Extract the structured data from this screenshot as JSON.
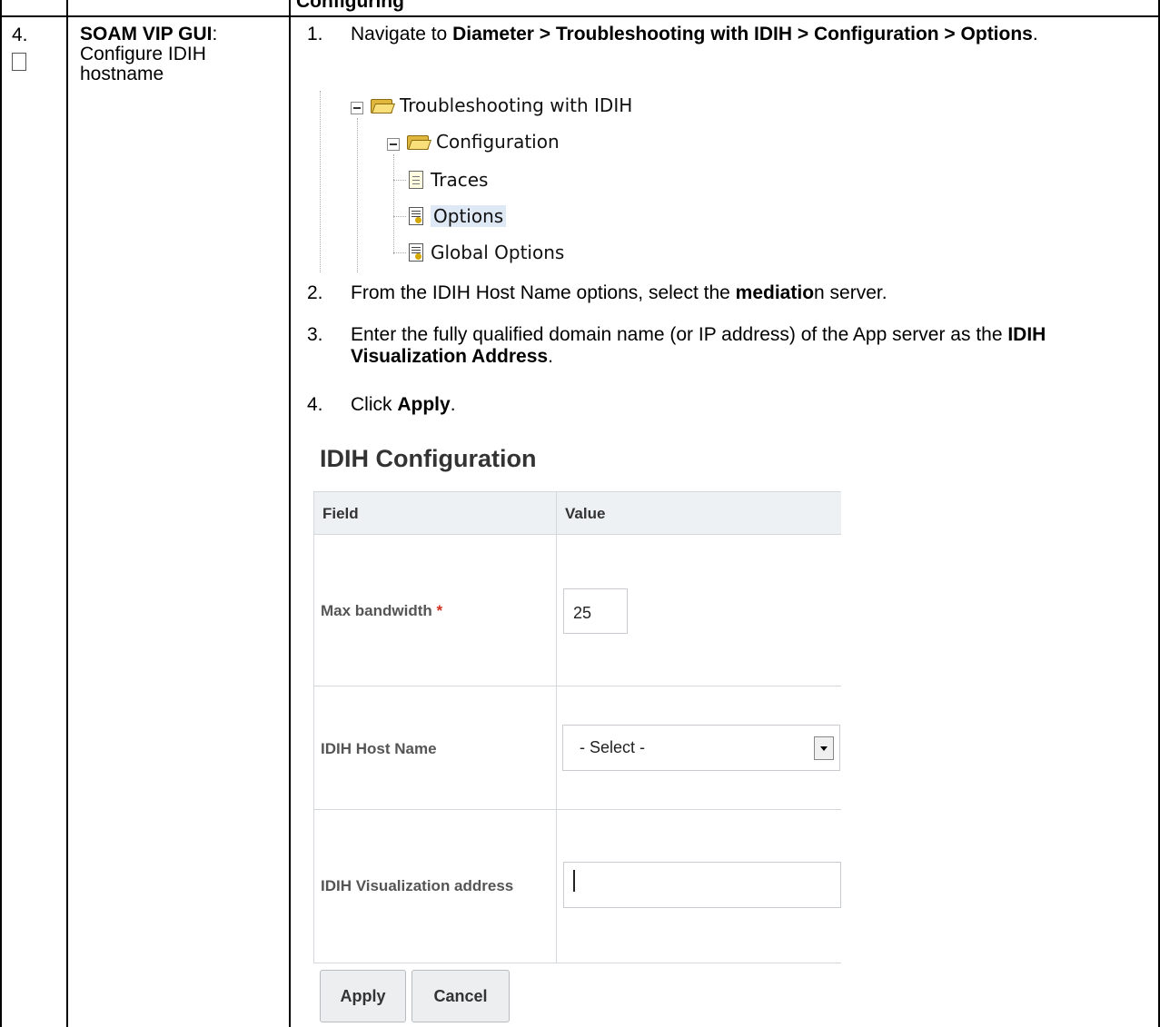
{
  "step": {
    "number": "4.",
    "title": "SOAM VIP GUI",
    "title_suffix": ":",
    "description": "Configure IDIH hostname"
  },
  "top_cut_text": "Configuring",
  "instructions": {
    "item1": {
      "num": "1.",
      "prefix": "Navigate to ",
      "bold": "Diameter > Troubleshooting with IDIH > Configuration > Options",
      "suffix": "."
    },
    "item2": {
      "num": "2.",
      "prefix": "From the IDIH Host Name options, select the ",
      "bold": "mediatio",
      "suffix": "n server."
    },
    "item3": {
      "num": "3.",
      "prefix": "Enter the fully qualified domain name (or IP address) of the App server as the ",
      "bold": "IDIH Visualization Address",
      "suffix": "."
    },
    "item4": {
      "num": "4.",
      "prefix": "Click ",
      "bold": "Apply",
      "suffix": "."
    }
  },
  "tree": {
    "root": "Troubleshooting with IDIH",
    "child": "Configuration",
    "leaves": [
      "Traces",
      "Options",
      "Global Options"
    ],
    "selected": "Options"
  },
  "idih_config": {
    "title": "IDIH Configuration",
    "col_field": "Field",
    "col_value": "Value",
    "rows": {
      "max_bandwidth": {
        "label": "Max bandwidth",
        "required_mark": "*",
        "value": "25"
      },
      "host_name": {
        "label": "IDIH Host Name",
        "selected": "- Select -"
      },
      "visualization": {
        "label": "IDIH Visualization address",
        "value": ""
      }
    },
    "apply_label": "Apply",
    "cancel_label": "Cancel"
  }
}
